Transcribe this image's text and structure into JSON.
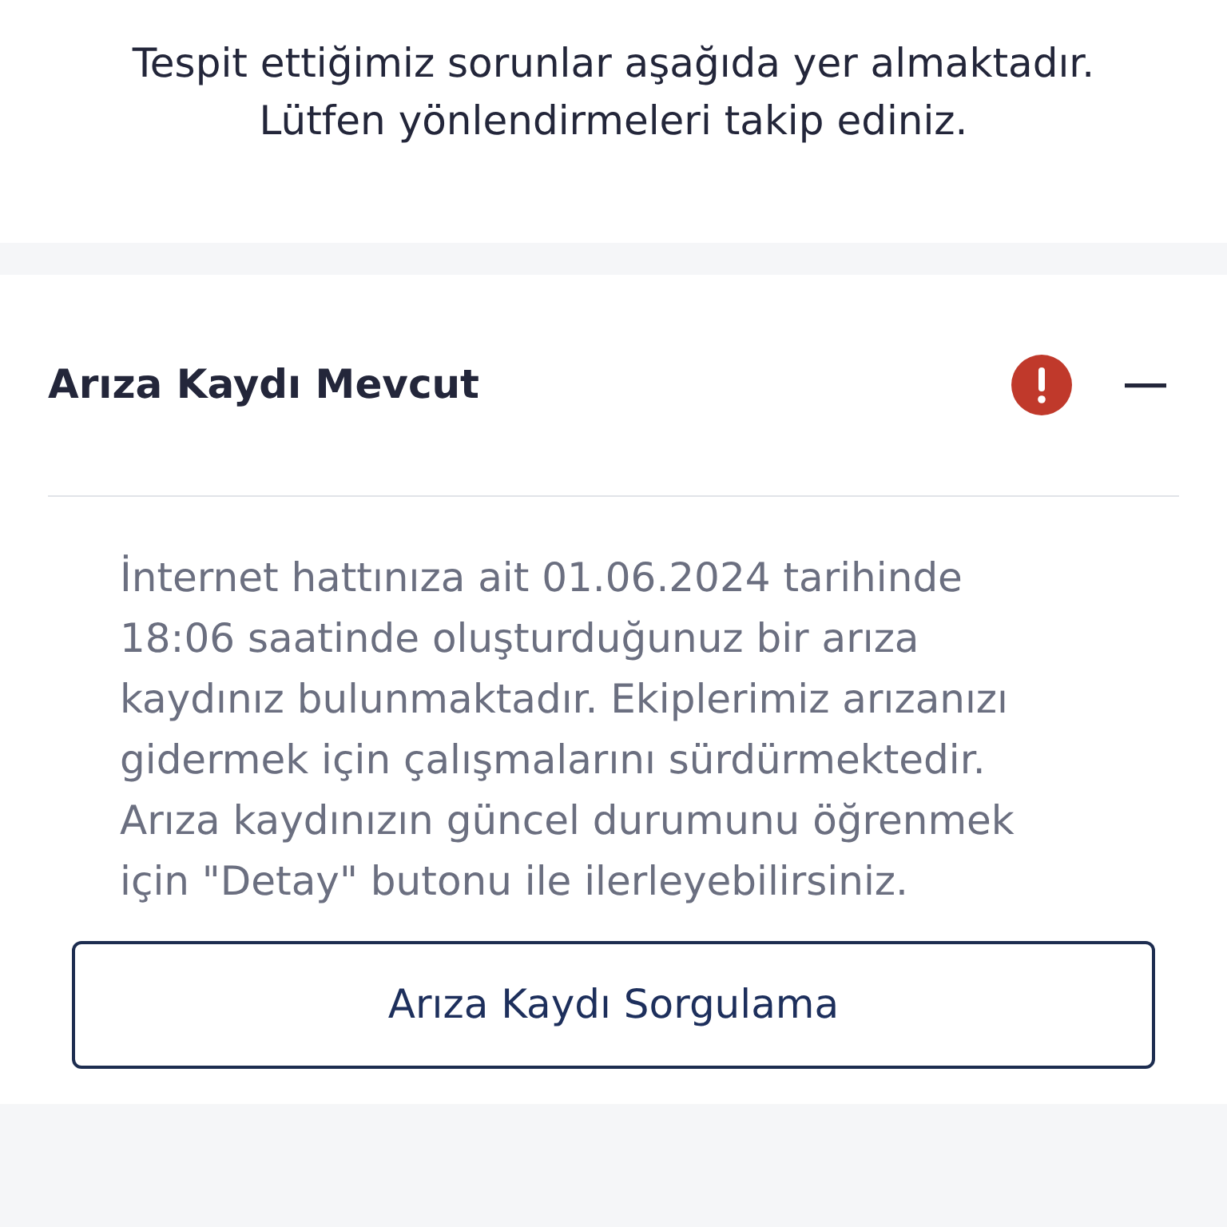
{
  "intro": [
    "Tespit ettiğimiz sorunlar aşağıda yer almaktadır.",
    "Lütfen yönlendirmeleri takip ediniz."
  ],
  "issues": [
    {
      "title": "Arıza Kaydı Mevcut",
      "alert": true,
      "expanded": true,
      "description": "İnternet hattınıza ait 01.06.2024 tarihinde 18:06 saatinde oluşturduğunuz bir arıza kaydınız bulunmaktadır. Ekiplerimiz arızanızı gidermek için çalışmalarını sürdürmektedir. Arıza kaydınızın güncel durumunu öğrenmek için \"Detay\" butonu ile ilerleyebilirsiniz.",
      "button": "Arıza Kaydı Sorgulama"
    }
  ]
}
